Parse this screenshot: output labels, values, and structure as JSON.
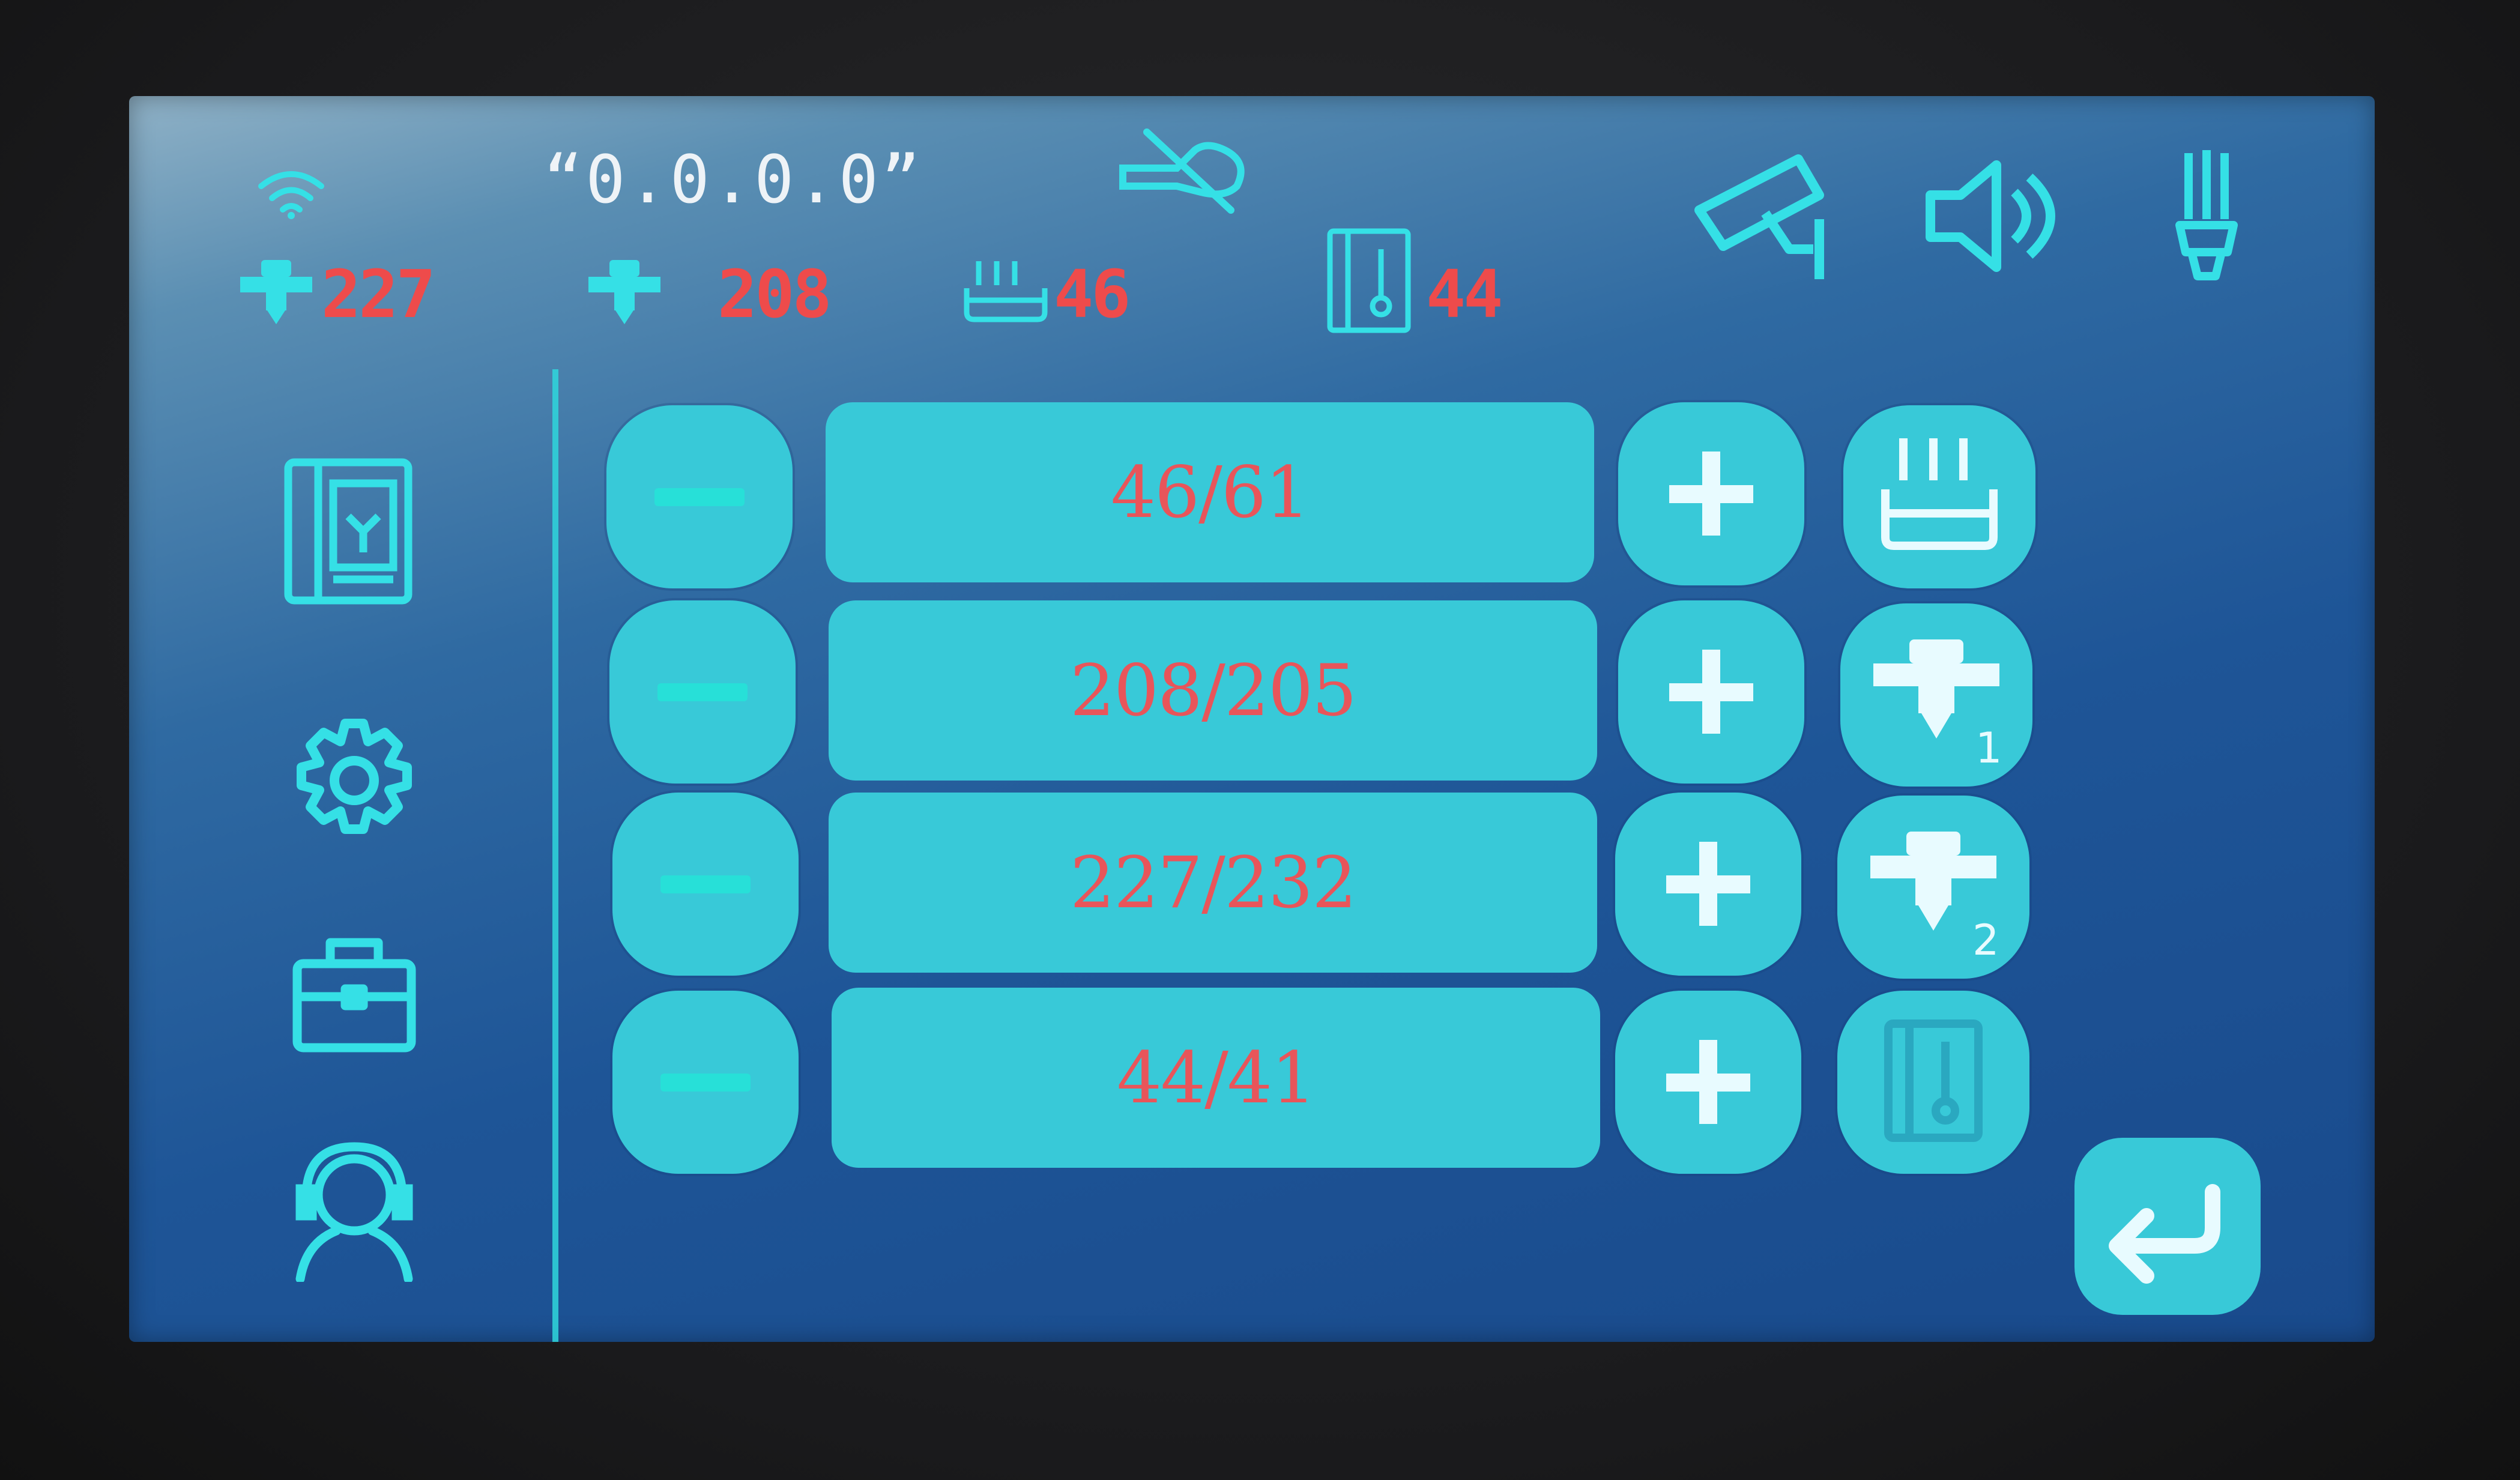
{
  "status_bar": {
    "ip_address": "“0.0.0.0”",
    "nozzle2_temp": "227",
    "nozzle1_temp": "208",
    "bed_temp": "46",
    "chamber_temp": "44",
    "icons": [
      "wifi-icon",
      "nozzle-icon",
      "nozzle-icon",
      "heated-bed-icon",
      "chamber-icon",
      "no-hand-icon",
      "camera-icon",
      "speaker-icon",
      "light-icon"
    ]
  },
  "sidebar": {
    "items": [
      {
        "name": "printer-icon"
      },
      {
        "name": "gear-icon"
      },
      {
        "name": "toolbox-icon"
      },
      {
        "name": "support-icon"
      }
    ]
  },
  "heaters": [
    {
      "label": "46/61",
      "icon": "heated-bed-icon"
    },
    {
      "label": "208/205",
      "icon": "nozzle-1-icon",
      "sub": "1"
    },
    {
      "label": "227/232",
      "icon": "nozzle-2-icon",
      "sub": "2"
    },
    {
      "label": "44/41",
      "icon": "chamber-icon"
    }
  ],
  "colors": {
    "accent": "#38c9d8",
    "icon": "#35e0e6",
    "temp_text": "#ee4b4b",
    "background": "#1e5597"
  }
}
